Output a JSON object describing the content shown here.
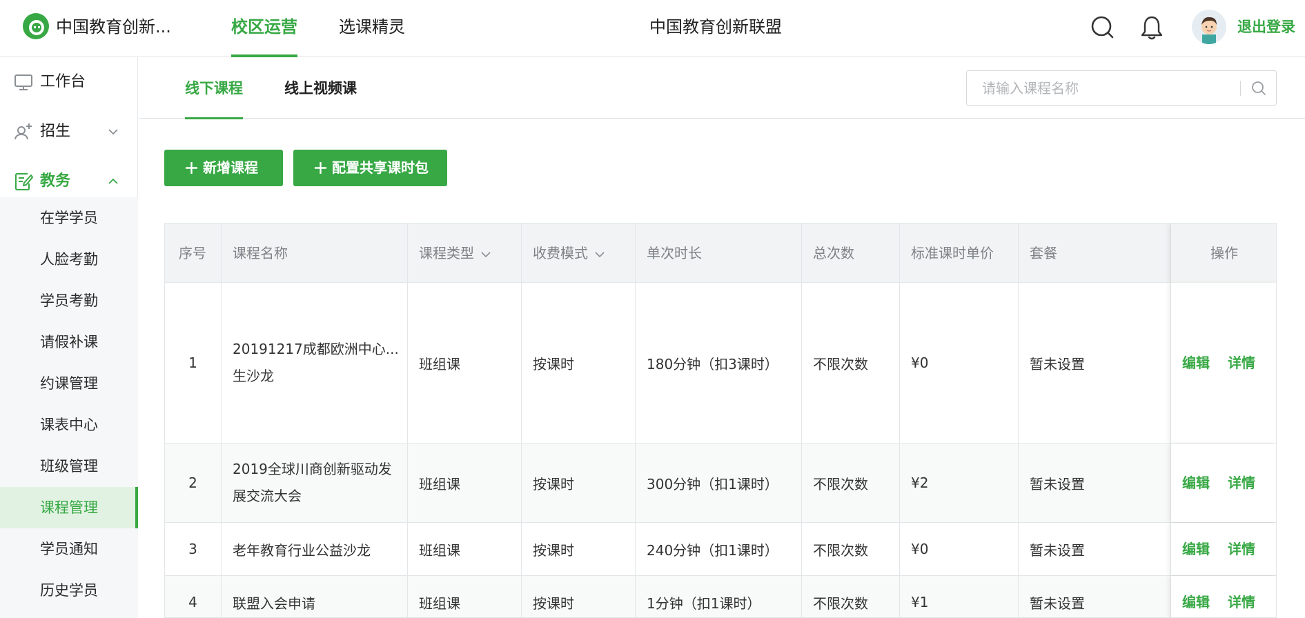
{
  "header": {
    "brand": "中国教育创新...",
    "nav": [
      {
        "label": "校区运营",
        "active": true
      },
      {
        "label": "选课精灵",
        "active": false
      }
    ],
    "center_title": "中国教育创新联盟",
    "logout_label": "退出登录",
    "accent_color": "#37a844"
  },
  "sidebar": {
    "groups": [
      {
        "label": "工作台",
        "icon": "monitor-icon"
      },
      {
        "label": "招生",
        "icon": "user-add-icon"
      },
      {
        "label": "教务",
        "icon": "edit-doc-icon"
      }
    ],
    "submenu": [
      "在学学员",
      "人脸考勤",
      "学员考勤",
      "请假补课",
      "约课管理",
      "课表中心",
      "班级管理",
      "课程管理",
      "学员通知",
      "历史学员"
    ],
    "active_sub": "课程管理"
  },
  "tabs": [
    {
      "label": "线下课程",
      "active": true
    },
    {
      "label": "线上视频课",
      "active": false
    }
  ],
  "search": {
    "placeholder": "请输入课程名称"
  },
  "buttons": {
    "add_course": "新增课程",
    "share_package": "配置共享课时包"
  },
  "table": {
    "columns": [
      "序号",
      "课程名称",
      "课程类型",
      "收费模式",
      "单次时长",
      "总次数",
      "标准课时单价",
      "套餐",
      "操作"
    ],
    "rows": [
      {
        "no": "1",
        "name_line1": "20191217成都欧洲中心...",
        "name_line2": "生沙龙",
        "type": "班组课",
        "fee": "按课时",
        "duration": "180分钟（扣3课时）",
        "count": "不限次数",
        "price": "¥0",
        "package": "暂未设置"
      },
      {
        "no": "2",
        "name_line1": "2019全球川商创新驱动发",
        "name_line2": "展交流大会",
        "type": "班组课",
        "fee": "按课时",
        "duration": "300分钟（扣1课时）",
        "count": "不限次数",
        "price": "¥2",
        "package": "暂未设置"
      },
      {
        "no": "3",
        "name_line1": "老年教育行业公益沙龙",
        "name_line2": "",
        "type": "班组课",
        "fee": "按课时",
        "duration": "240分钟（扣1课时）",
        "count": "不限次数",
        "price": "¥0",
        "package": "暂未设置"
      },
      {
        "no": "4",
        "name_line1": "联盟入会申请",
        "name_line2": "",
        "type": "班组课",
        "fee": "按课时",
        "duration": "1分钟（扣1课时）",
        "count": "不限次数",
        "price": "¥1",
        "package": "暂未设置"
      }
    ],
    "edit_label": "编辑",
    "detail_label": "详情"
  }
}
